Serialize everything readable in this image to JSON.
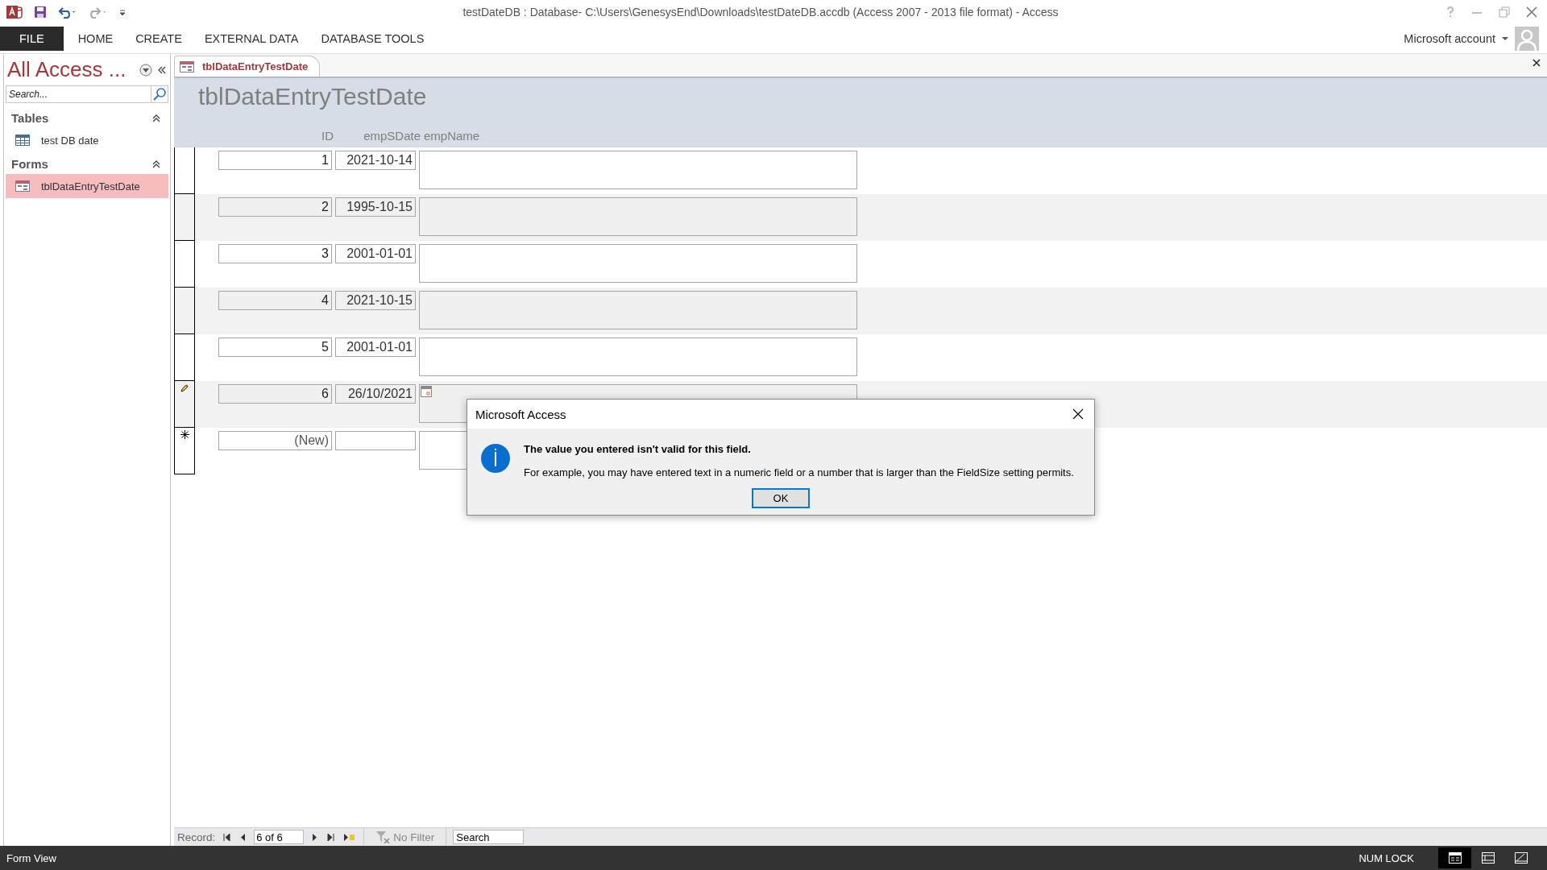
{
  "window": {
    "title": "testDateDB : Database- C:\\Users\\GenesysEnd\\Downloads\\testDateDB.accdb (Access 2007 - 2013 file format) - Access"
  },
  "ribbon": {
    "tabs": [
      {
        "label": "FILE",
        "kind": "file"
      },
      {
        "label": "HOME",
        "kind": "tab"
      },
      {
        "label": "CREATE",
        "kind": "tab"
      },
      {
        "label": "EXTERNAL DATA",
        "kind": "tab"
      },
      {
        "label": "DATABASE TOOLS",
        "kind": "tab"
      }
    ],
    "account": "Microsoft account"
  },
  "nav_pane": {
    "title": "All Access ...",
    "search": {
      "placeholder": "Search..."
    },
    "groups": [
      {
        "label": "Tables",
        "expanded": true,
        "items": [
          {
            "label": "test DB date",
            "kind": "table",
            "selected": false
          }
        ]
      },
      {
        "label": "Forms",
        "expanded": true,
        "items": [
          {
            "label": "tblDataEntryTestDate",
            "kind": "form",
            "selected": true
          }
        ]
      }
    ]
  },
  "document_tab": {
    "label": "tblDataEntryTestDate"
  },
  "form": {
    "title": "tblDataEntryTestDate",
    "columns": [
      "ID",
      "empSDate",
      "empName"
    ],
    "records": [
      {
        "kind": "record",
        "id": "1",
        "date": "2021-10-14",
        "editing": false
      },
      {
        "kind": "record",
        "id": "2",
        "date": "1995-10-15",
        "editing": false
      },
      {
        "kind": "record",
        "id": "3",
        "date": "2001-01-01",
        "editing": false
      },
      {
        "kind": "record",
        "id": "4",
        "date": "2021-10-15",
        "editing": false
      },
      {
        "kind": "record",
        "id": "5",
        "date": "2001-01-01",
        "editing": false
      },
      {
        "kind": "record",
        "id": "6",
        "date": "26/10/2021",
        "editing": true
      },
      {
        "kind": "new",
        "id": "(New)",
        "editing": false
      }
    ]
  },
  "record_nav": {
    "label": "Record:",
    "position": "6 of 6",
    "filter": "No Filter",
    "search": {
      "placeholder": "Search"
    }
  },
  "status_bar": {
    "mode": "Form View",
    "indicator": "NUM LOCK",
    "views": [
      {
        "selected": true
      },
      {
        "selected": false
      },
      {
        "selected": false
      }
    ]
  },
  "dialog": {
    "title": "Microsoft Access",
    "message": "The value you entered isn't valid for this field.",
    "detail": "For example, you may have entered text in a numeric field or a number that is larger than the FieldSize setting permits.",
    "buttons": [
      "OK"
    ]
  }
}
